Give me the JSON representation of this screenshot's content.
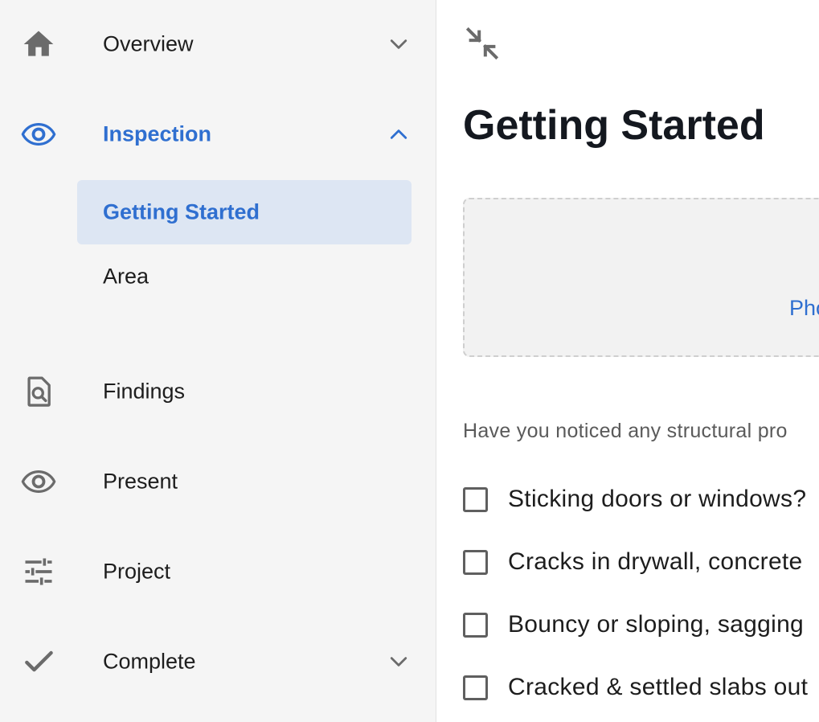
{
  "sidebar": {
    "items": [
      {
        "label": "Overview",
        "icon": "home-icon",
        "expanded": false
      },
      {
        "label": "Inspection",
        "icon": "eye-icon",
        "expanded": true,
        "active": true,
        "children": [
          {
            "label": "Getting Started",
            "selected": true
          },
          {
            "label": "Area",
            "selected": false
          }
        ]
      },
      {
        "label": "Findings",
        "icon": "document-search-icon"
      },
      {
        "label": "Present",
        "icon": "eye-icon"
      },
      {
        "label": "Project",
        "icon": "tune-sliders-icon"
      },
      {
        "label": "Complete",
        "icon": "checkmark-icon",
        "expanded": false
      }
    ]
  },
  "main": {
    "collapse_icon": "collapse-arrows-icon",
    "title": "Getting Started",
    "dropzone_link": "Pho",
    "question": "Have you noticed any structural pro",
    "checklist": [
      {
        "label": "Sticking doors or windows?",
        "checked": false
      },
      {
        "label": "Cracks in drywall, concrete",
        "checked": false
      },
      {
        "label": "Bouncy or sloping, sagging",
        "checked": false
      },
      {
        "label": "Cracked & settled slabs out",
        "checked": false
      }
    ]
  },
  "colors": {
    "accent": "#2f6fd0",
    "sidebar_bg": "#f5f5f5",
    "selected_bg": "#dde6f3",
    "icon_gray": "#6b6b6b",
    "title_text": "#14181f"
  }
}
